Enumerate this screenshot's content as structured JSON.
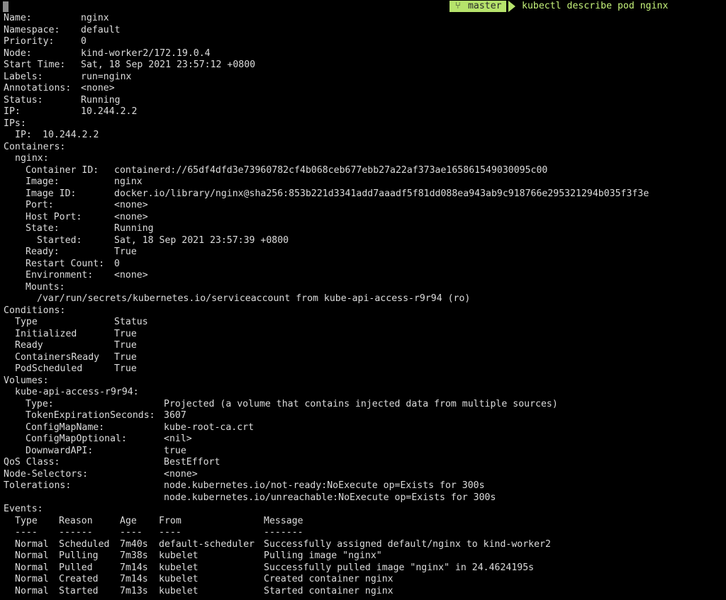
{
  "prompt": {
    "branch": "master",
    "command": "kubectl describe pod nginx"
  },
  "pod": {
    "name": "nginx",
    "namespace": "default",
    "priority": "0",
    "node": "kind-worker2/172.19.0.4",
    "start_time": "Sat, 18 Sep 2021 23:57:12 +0800",
    "labels": "run=nginx",
    "annotations": "<none>",
    "status": "Running",
    "ip": "10.244.2.2",
    "ips_ip": "10.244.2.2"
  },
  "container": {
    "name": "nginx:",
    "container_id": "containerd://65df4dfd3e73960782cf4b068ceb677ebb27a22af373ae165861549030095c00",
    "image": "nginx",
    "image_id": "docker.io/library/nginx@sha256:853b221d3341add7aaadf5f81dd088ea943ab9c918766e295321294b035f3f3e",
    "port": "<none>",
    "host_port": "<none>",
    "state": "Running",
    "started": "Sat, 18 Sep 2021 23:57:39 +0800",
    "ready": "True",
    "restart_count": "0",
    "environment": "<none>",
    "mount": "/var/run/secrets/kubernetes.io/serviceaccount from kube-api-access-r9r94 (ro)"
  },
  "conditions": {
    "header": {
      "type": "Type",
      "status": "Status"
    },
    "rows": [
      {
        "type": "Initialized",
        "status": "True"
      },
      {
        "type": "Ready",
        "status": "True"
      },
      {
        "type": "ContainersReady",
        "status": "True"
      },
      {
        "type": "PodScheduled",
        "status": "True"
      }
    ]
  },
  "volumes": {
    "name": "kube-api-access-r9r94:",
    "type": "Projected (a volume that contains injected data from multiple sources)",
    "token_expiration": "3607",
    "config_map_name": "kube-root-ca.crt",
    "config_map_optional": "<nil>",
    "downward_api": "true"
  },
  "qos_class": "BestEffort",
  "node_selectors": "<none>",
  "tolerations": [
    "node.kubernetes.io/not-ready:NoExecute op=Exists for 300s",
    "node.kubernetes.io/unreachable:NoExecute op=Exists for 300s"
  ],
  "events": {
    "header": {
      "type": "Type",
      "reason": "Reason",
      "age": "Age",
      "from": "From",
      "message": "Message"
    },
    "separator": {
      "type": "----",
      "reason": "------",
      "age": "----",
      "from": "----",
      "message": "-------"
    },
    "rows": [
      {
        "type": "Normal",
        "reason": "Scheduled",
        "age": "7m40s",
        "from": "default-scheduler",
        "message": "Successfully assigned default/nginx to kind-worker2"
      },
      {
        "type": "Normal",
        "reason": "Pulling",
        "age": "7m38s",
        "from": "kubelet",
        "message": "Pulling image \"nginx\""
      },
      {
        "type": "Normal",
        "reason": "Pulled",
        "age": "7m14s",
        "from": "kubelet",
        "message": "Successfully pulled image \"nginx\" in 24.4624195s"
      },
      {
        "type": "Normal",
        "reason": "Created",
        "age": "7m14s",
        "from": "kubelet",
        "message": "Created container nginx"
      },
      {
        "type": "Normal",
        "reason": "Started",
        "age": "7m13s",
        "from": "kubelet",
        "message": "Started container nginx"
      }
    ]
  },
  "theme": {
    "background": "#000000",
    "text": "#dcdcdc",
    "prompt_accent": "#b6e36b",
    "command_text": "#c5f27a"
  }
}
